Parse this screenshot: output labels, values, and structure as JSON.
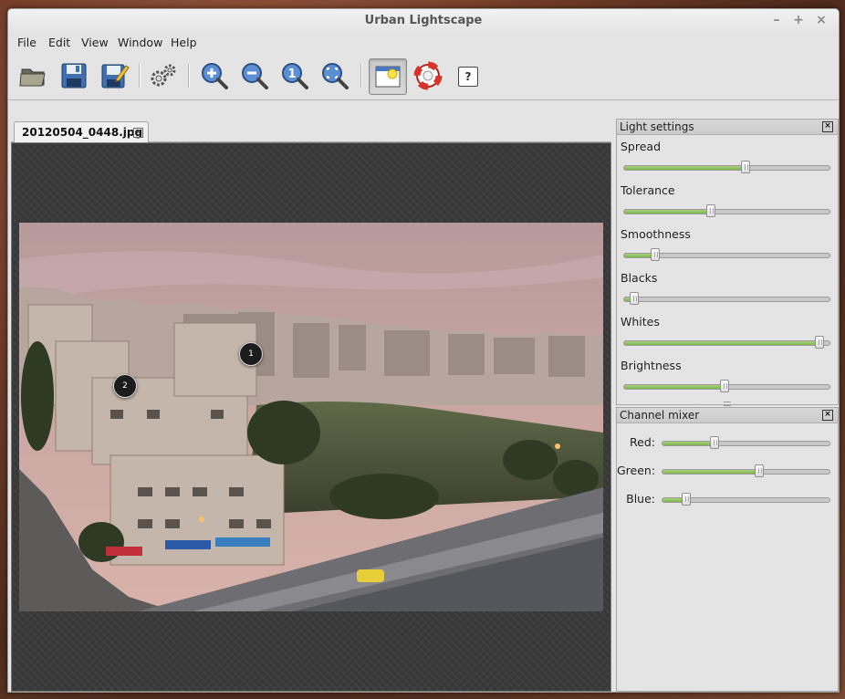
{
  "window": {
    "title": "Urban Lightscape"
  },
  "window_controls": {
    "minimize": "–",
    "maximize": "+",
    "close": "×"
  },
  "menu": [
    "File",
    "Edit",
    "View",
    "Window",
    "Help"
  ],
  "toolbar": [
    {
      "icon": "open-folder-icon"
    },
    {
      "icon": "save-icon"
    },
    {
      "icon": "save-as-icon"
    },
    {
      "icon": "settings-gear-icon"
    },
    {
      "icon": "zoom-in-icon"
    },
    {
      "icon": "zoom-out-icon"
    },
    {
      "icon": "zoom-actual-size-icon"
    },
    {
      "icon": "zoom-fit-icon"
    },
    {
      "icon": "light-mode-icon",
      "active": true
    },
    {
      "icon": "help-lifebuoy-icon"
    },
    {
      "icon": "whats-this-icon",
      "label": "?"
    }
  ],
  "document": {
    "tab_label": "20120504_0448.jpg",
    "tab_close": "×",
    "markers": [
      "1",
      "2"
    ]
  },
  "light_settings": {
    "title": "Light settings",
    "close": "×",
    "sliders": [
      {
        "label": "Spread",
        "value": 0.59
      },
      {
        "label": "Tolerance",
        "value": 0.42
      },
      {
        "label": "Smoothness",
        "value": 0.15
      },
      {
        "label": "Blacks",
        "value": 0.05
      },
      {
        "label": "Whites",
        "value": 0.95
      },
      {
        "label": "Brightness",
        "value": 0.49
      }
    ]
  },
  "channel_mixer": {
    "title": "Channel mixer",
    "close": "×",
    "sliders": [
      {
        "label": "Red:",
        "value": 0.31
      },
      {
        "label": "Green:",
        "value": 0.58
      },
      {
        "label": "Blue:",
        "value": 0.14
      }
    ]
  },
  "colors": {
    "accent_green": "#7db34c",
    "canvas_bg": "#3a3a3a",
    "chrome_bg": "#e4e4e4"
  }
}
